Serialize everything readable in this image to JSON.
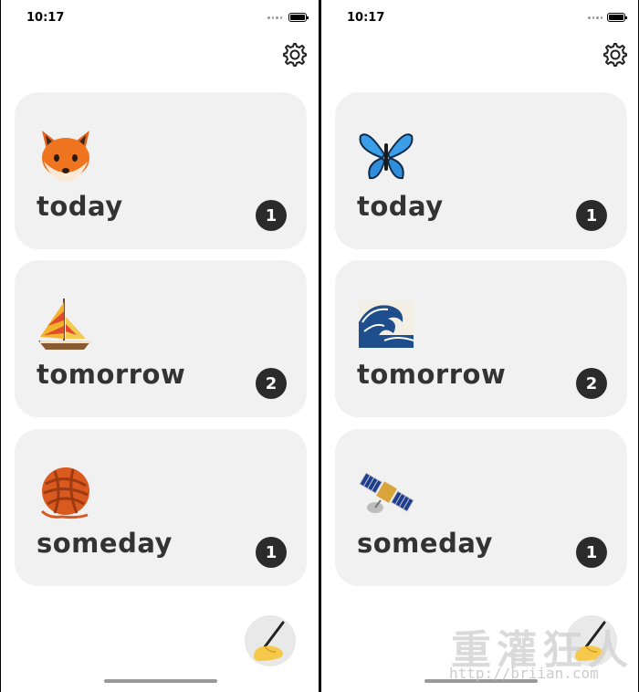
{
  "screens": [
    {
      "status_time": "10:17",
      "cards": [
        {
          "label": "today",
          "badge": "1",
          "emoji": "fox-face-icon"
        },
        {
          "label": "tomorrow",
          "badge": "2",
          "emoji": "sailboat-icon"
        },
        {
          "label": "someday",
          "badge": "1",
          "emoji": "yarn-icon"
        }
      ]
    },
    {
      "status_time": "10:17",
      "cards": [
        {
          "label": "today",
          "badge": "1",
          "emoji": "butterfly-icon"
        },
        {
          "label": "tomorrow",
          "badge": "2",
          "emoji": "water-wave-icon"
        },
        {
          "label": "someday",
          "badge": "1",
          "emoji": "satellite-icon"
        }
      ]
    }
  ],
  "icons": {
    "settings": "gear-icon",
    "compose": "writing-hand-icon"
  },
  "colors": {
    "card_background": "#f1f1f1",
    "badge_background": "#2b2b2b",
    "label_text": "#333333"
  },
  "watermark": {
    "title": "重灌狂人",
    "url": "http://briian.com"
  }
}
